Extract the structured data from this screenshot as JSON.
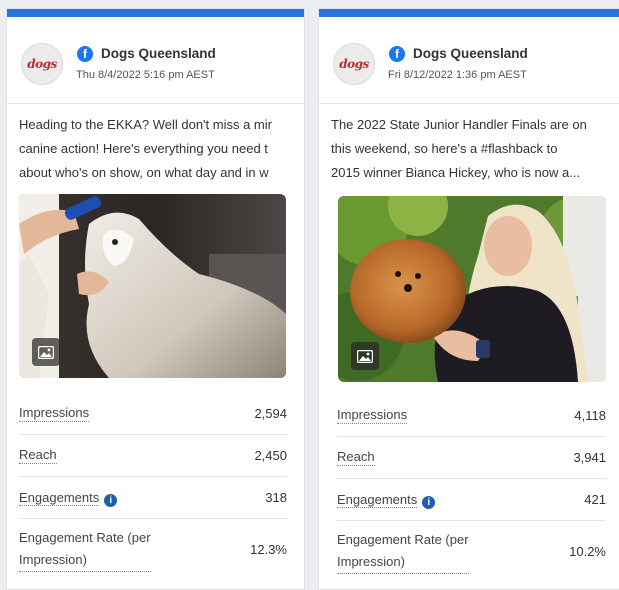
{
  "posts": [
    {
      "page_name": "Dogs Queensland",
      "avatar_text": "dogs",
      "date": "Thu 8/4/2022 5:16 pm AEST",
      "text_lines": [
        "Heading to the EKKA? Well don't miss a mir",
        "canine action! Here's everything you need t",
        "about who's on show, on what day and in w"
      ],
      "metrics": [
        {
          "label": "Impressions",
          "value": "2,594"
        },
        {
          "label": "Reach",
          "value": "2,450"
        },
        {
          "label": "Engagements",
          "value": "318"
        },
        {
          "label": "Engagement Rate (per Impression)",
          "label_line1": "Engagement Rate (per",
          "label_line2": "Impression)",
          "value": "12.3%"
        }
      ]
    },
    {
      "page_name": "Dogs Queensland",
      "avatar_text": "dogs",
      "date": "Fri 8/12/2022 1:36 pm AEST",
      "text_lines": [
        "The 2022 State Junior Handler Finals are on",
        "this weekend, so here's a #flashback to",
        "2015 winner Bianca Hickey, who is now a..."
      ],
      "metrics": [
        {
          "label": "Impressions",
          "value": "4,118"
        },
        {
          "label": "Reach",
          "value": "3,941"
        },
        {
          "label": "Engagements",
          "value": "421"
        },
        {
          "label": "Engagement Rate (per Impression)",
          "label_line1": "Engagement Rate (per",
          "label_line2": "Impression)",
          "value": "10.2%"
        }
      ]
    }
  ],
  "icons": {
    "facebook": "facebook-icon",
    "info": "info-icon",
    "photo": "image-icon"
  },
  "colors": {
    "accent_bar": "#2c75dc",
    "facebook_blue": "#1877f2",
    "info_blue": "#1a5fb4"
  }
}
